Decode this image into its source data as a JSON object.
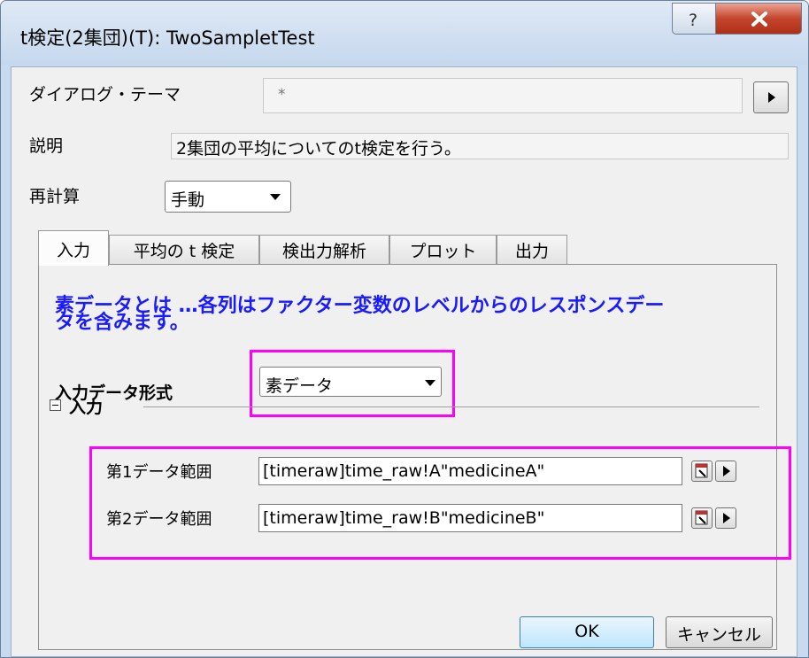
{
  "window": {
    "title": "t検定(2集団)(T): TwoSampletTest",
    "help_glyph": "?",
    "close_glyph": "X"
  },
  "dialog_theme": {
    "label": "ダイアログ・テーマ",
    "value": "*"
  },
  "description": {
    "label": "説明",
    "value": "2集団の平均についてのt検定を行う。"
  },
  "recalculate": {
    "label": "再計算",
    "value": "手動"
  },
  "tabs": [
    {
      "label": "入力",
      "active": true
    },
    {
      "label": "平均の t 検定",
      "active": false
    },
    {
      "label": "検出力解析",
      "active": false
    },
    {
      "label": "プロット",
      "active": false
    },
    {
      "label": "出力",
      "active": false
    }
  ],
  "input_tab": {
    "hint_line1": "素データとは …各列はファクター変数のレベルからのレスポンスデー",
    "hint_line2": "タを含みます。",
    "format_label": "入力データ形式",
    "format_value": "素データ",
    "group_label": "入力",
    "ranges": [
      {
        "label": "第1データ範囲",
        "value": "[timeraw]time_raw!A\"medicineA\""
      },
      {
        "label": "第2データ範囲",
        "value": "[timeraw]time_raw!B\"medicineB\""
      }
    ]
  },
  "footer": {
    "ok_label": "OK",
    "cancel_label": "キャンセル"
  },
  "colors": {
    "highlight": "#ff00ff",
    "hint_text": "#1a1aff",
    "title_bar": "#c8daf0",
    "close_button": "#c5452c"
  }
}
